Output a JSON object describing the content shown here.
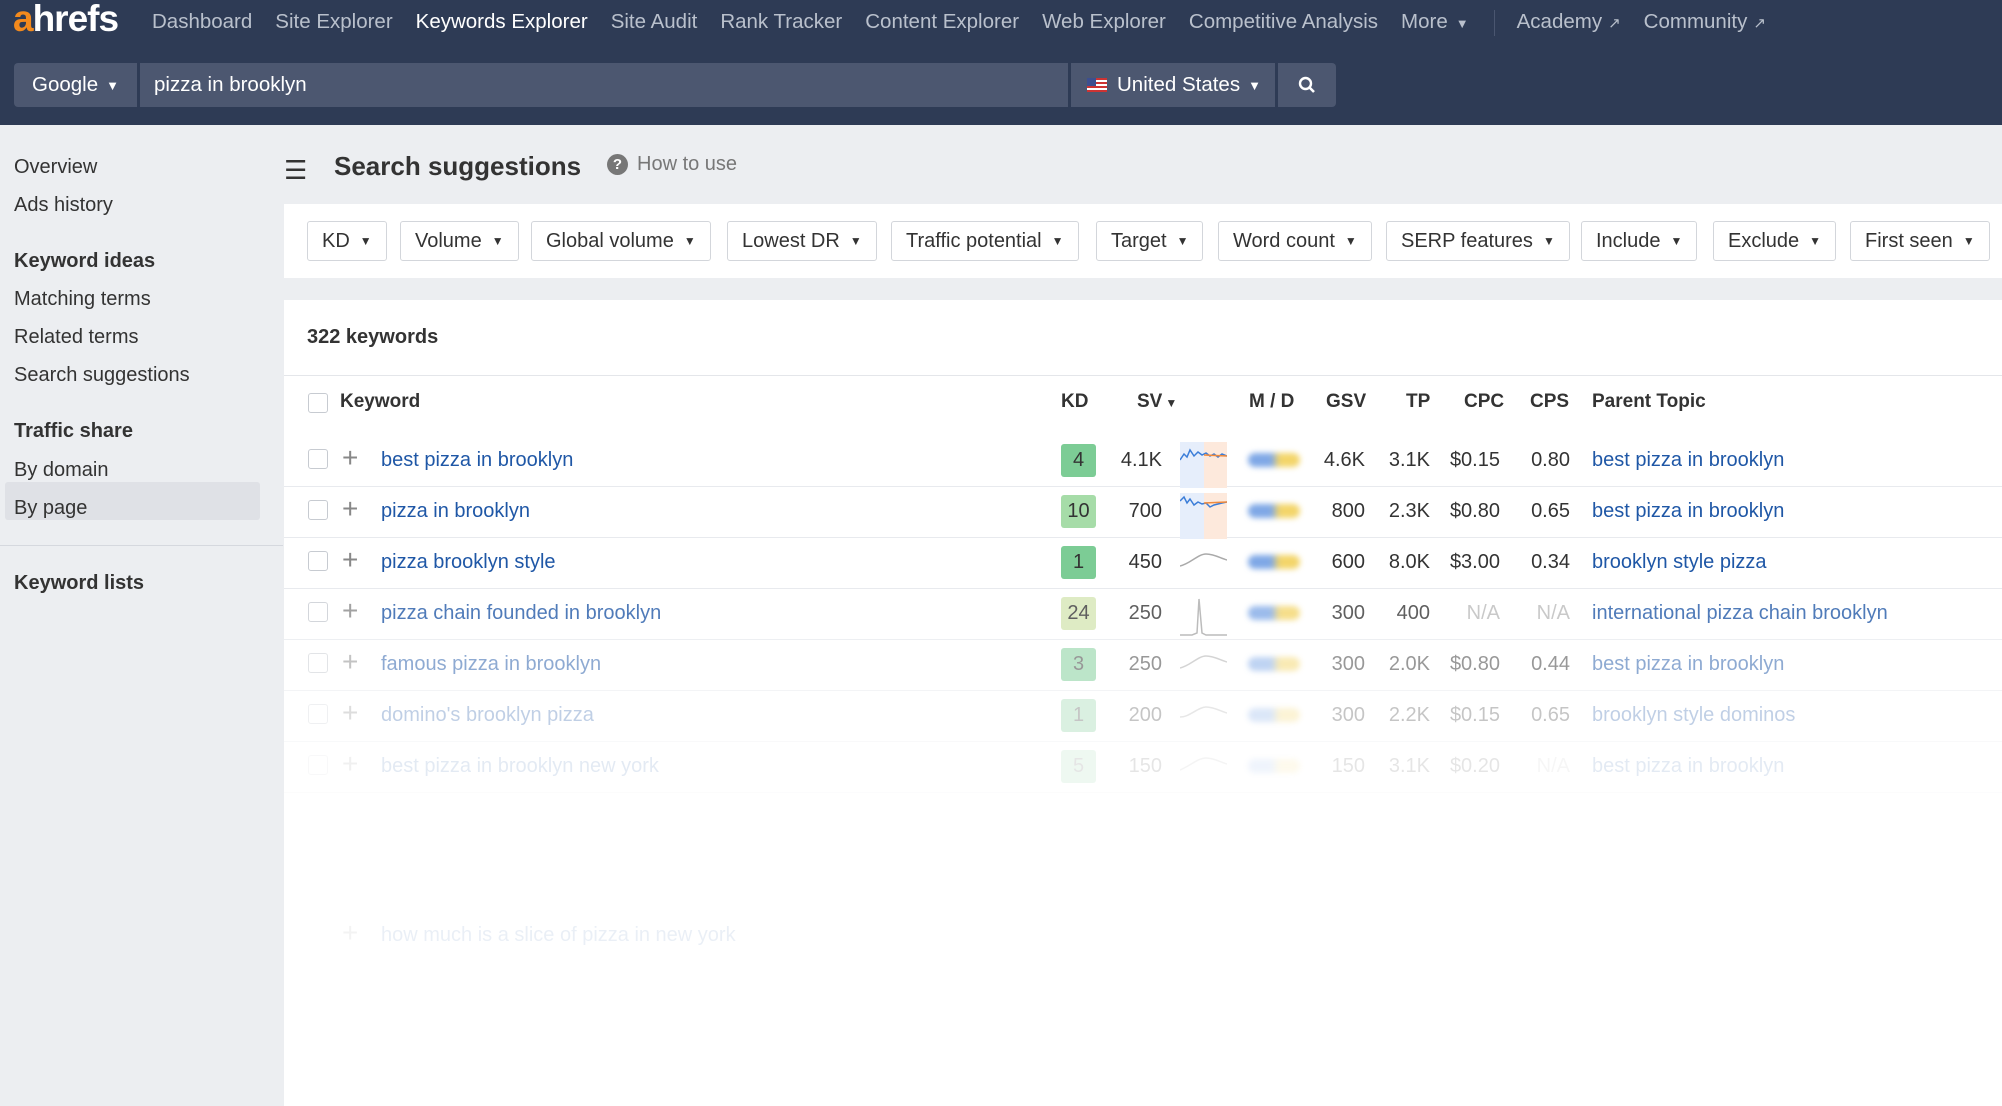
{
  "brand": {
    "logo_first": "a",
    "logo_rest": "hrefs",
    "accent": "#f38a1d",
    "topbar": "#2e3b55"
  },
  "nav": {
    "items": [
      "Dashboard",
      "Site Explorer",
      "Keywords Explorer",
      "Site Audit",
      "Rank Tracker",
      "Content Explorer",
      "Web Explorer",
      "Competitive Analysis",
      "More"
    ],
    "active": "Keywords Explorer",
    "external": [
      "Academy",
      "Community"
    ]
  },
  "search": {
    "engine": "Google",
    "query": "pizza in brooklyn",
    "country": "United States",
    "country_icon": "us-flag-icon",
    "button_icon": "search-icon"
  },
  "sidebar": {
    "overview": "Overview",
    "ads_history": "Ads history",
    "keyword_ideas": "Keyword ideas",
    "matching_terms": "Matching terms",
    "related_terms": "Related terms",
    "search_suggestions": "Search suggestions",
    "traffic_share": "Traffic share",
    "by_domain": "By domain",
    "by_page": "By page",
    "keyword_lists": "Keyword lists",
    "active": "Search suggestions"
  },
  "page": {
    "title": "Search suggestions",
    "how_to": "How to use"
  },
  "filters": [
    "KD",
    "Volume",
    "Global volume",
    "Lowest DR",
    "Traffic potential",
    "Target",
    "Word count",
    "SERP features",
    "Include",
    "Exclude",
    "First seen"
  ],
  "table": {
    "count": "322 keywords",
    "headers": {
      "keyword": "Keyword",
      "kd": "KD",
      "sv": "SV",
      "md": "M / D",
      "gsv": "GSV",
      "tp": "TP",
      "cpc": "CPC",
      "cps": "CPS",
      "parent": "Parent Topic"
    },
    "sort": "SV descending",
    "rows": [
      {
        "keyword": "best pizza in brooklyn",
        "kd": "4",
        "sv": "4.1K",
        "gsv": "4.6K",
        "tp": "3.1K",
        "cpc": "$0.15",
        "cps": "0.80",
        "parent": "best pizza in brooklyn",
        "kd_color": "#7ccc95"
      },
      {
        "keyword": "pizza in brooklyn",
        "kd": "10",
        "sv": "700",
        "gsv": "800",
        "tp": "2.3K",
        "cpc": "$0.80",
        "cps": "0.65",
        "parent": "best pizza in brooklyn",
        "kd_color": "#a6dca8"
      },
      {
        "keyword": "pizza brooklyn style",
        "kd": "1",
        "sv": "450",
        "gsv": "600",
        "tp": "8.0K",
        "cpc": "$3.00",
        "cps": "0.34",
        "parent": "brooklyn style pizza",
        "kd_color": "#7ccc95"
      },
      {
        "keyword": "pizza chain founded in brooklyn",
        "kd": "24",
        "sv": "250",
        "gsv": "300",
        "tp": "400",
        "cpc": "N/A",
        "cps": "N/A",
        "parent": "international pizza chain brooklyn",
        "kd_color": "#d6e6b4"
      },
      {
        "keyword": "famous pizza in brooklyn",
        "kd": "3",
        "sv": "250",
        "gsv": "300",
        "tp": "2.0K",
        "cpc": "$0.80",
        "cps": "0.44",
        "parent": "best pizza in brooklyn",
        "kd_color": "#7ccc95"
      },
      {
        "keyword": "domino's brooklyn pizza",
        "kd": "1",
        "sv": "200",
        "gsv": "300",
        "tp": "2.2K",
        "cpc": "$0.15",
        "cps": "0.65",
        "parent": "brooklyn style dominos",
        "kd_color": "#7ccc95"
      },
      {
        "keyword": "best pizza in brooklyn new york",
        "kd": "5",
        "sv": "150",
        "gsv": "150",
        "tp": "3.1K",
        "cpc": "$0.20",
        "cps": "N/A",
        "parent": "best pizza in brooklyn",
        "kd_color": "#7ccc95"
      }
    ],
    "trailing_row": "how much is a slice of pizza in new york"
  }
}
